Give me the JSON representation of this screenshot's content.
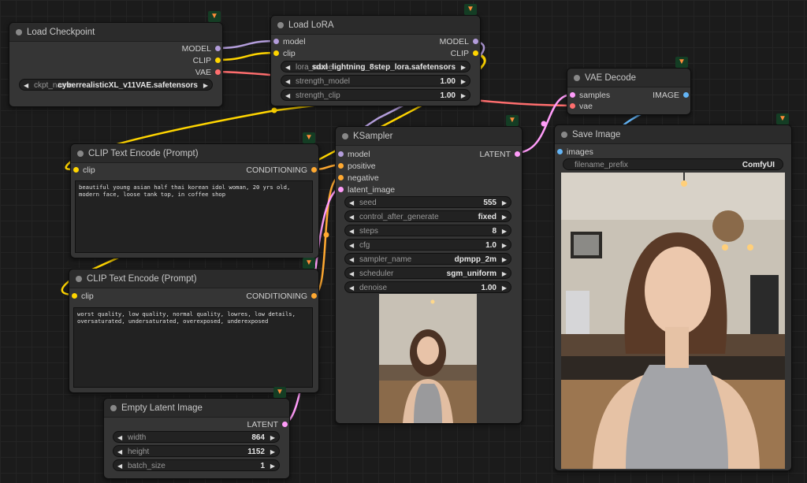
{
  "icon_badge": "fox-icon",
  "colors": {
    "model": "#b39ddb",
    "clip": "#ffd500",
    "vae": "#ff6e6e",
    "conditioning": "#ffa931",
    "latent": "#ff9cf9",
    "image": "#64b5f6"
  },
  "load_checkpoint": {
    "title": "Load Checkpoint",
    "out_model": "MODEL",
    "out_clip": "CLIP",
    "out_vae": "VAE",
    "ckpt_label": "ckpt_name",
    "ckpt_value": "cyberrealisticXL_v11VAE.safetensors"
  },
  "load_lora": {
    "title": "Load LoRA",
    "in_model": "model",
    "in_clip": "clip",
    "out_model": "MODEL",
    "out_clip": "CLIP",
    "lora_label": "lora_name",
    "lora_value": "sdxl_lightning_8step_lora.safetensors",
    "strength_model_label": "strength_model",
    "strength_model_value": "1.00",
    "strength_clip_label": "strength_clip",
    "strength_clip_value": "1.00"
  },
  "vae_decode": {
    "title": "VAE Decode",
    "in_samples": "samples",
    "in_vae": "vae",
    "out_image": "IMAGE"
  },
  "clip_pos": {
    "title": "CLIP Text Encode (Prompt)",
    "in_clip": "clip",
    "out_conditioning": "CONDITIONING",
    "text": "beautiful young asian half thai korean idol woman, 20 yrs old, modern face, loose tank top, in coffee shop"
  },
  "clip_neg": {
    "title": "CLIP Text Encode (Prompt)",
    "in_clip": "clip",
    "out_conditioning": "CONDITIONING",
    "text": "worst quality, low quality, normal quality, lowres, low details, oversaturated, undersaturated, overexposed, underexposed"
  },
  "ksampler": {
    "title": "KSampler",
    "in_model": "model",
    "in_positive": "positive",
    "in_negative": "negative",
    "in_latent": "latent_image",
    "out_latent": "LATENT",
    "widgets": [
      {
        "label": "seed",
        "value": "555"
      },
      {
        "label": "control_after_generate",
        "value": "fixed"
      },
      {
        "label": "steps",
        "value": "8"
      },
      {
        "label": "cfg",
        "value": "1.0"
      },
      {
        "label": "sampler_name",
        "value": "dpmpp_2m"
      },
      {
        "label": "scheduler",
        "value": "sgm_uniform"
      },
      {
        "label": "denoise",
        "value": "1.00"
      }
    ]
  },
  "save_image": {
    "title": "Save Image",
    "in_images": "images",
    "prefix_label": "filename_prefix",
    "prefix_value": "ComfyUI"
  },
  "empty_latent": {
    "title": "Empty Latent Image",
    "out_latent": "LATENT",
    "widgets": [
      {
        "label": "width",
        "value": "864"
      },
      {
        "label": "height",
        "value": "1152"
      },
      {
        "label": "batch_size",
        "value": "1"
      }
    ]
  }
}
